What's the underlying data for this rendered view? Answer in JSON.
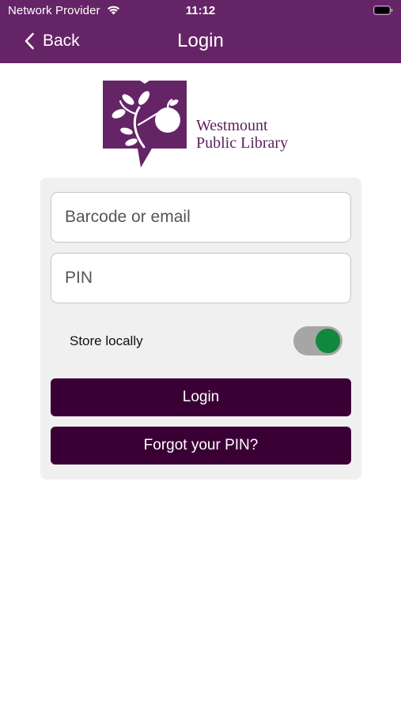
{
  "status_bar": {
    "carrier": "Network Provider",
    "time": "11:12",
    "wifi_icon": "wifi-icon",
    "battery_icon": "battery-icon"
  },
  "nav": {
    "back_label": "Back",
    "title": "Login",
    "color": "#652466"
  },
  "logo": {
    "line1": "Westmount",
    "line2": "Public Library",
    "color": "#652466"
  },
  "form": {
    "barcode_placeholder": "Barcode or email",
    "pin_placeholder": "PIN",
    "store_locally_label": "Store locally",
    "store_locally_on": true,
    "login_label": "Login",
    "forgot_label": "Forgot your PIN?",
    "button_color": "#3a0035",
    "toggle_color": "#11893c"
  }
}
